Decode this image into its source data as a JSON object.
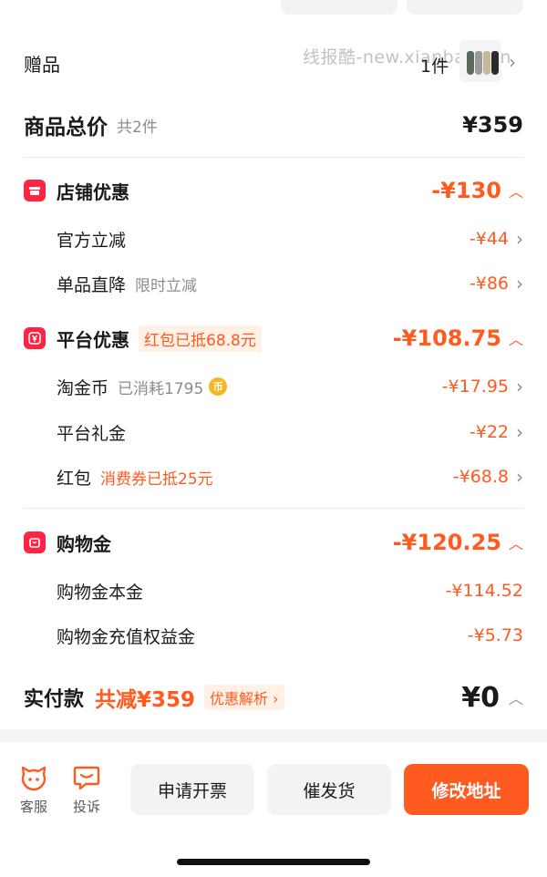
{
  "gift": {
    "label": "赠品",
    "watermark": "线报酷-new.xianbao.fun",
    "count": "1件",
    "chevron": "›"
  },
  "total": {
    "title": "商品总价",
    "count": "共2件",
    "price": "¥359"
  },
  "store_discount": {
    "title": "店铺优惠",
    "icon": "shop-icon",
    "amount": "-¥130",
    "items": [
      {
        "label": "官方立减",
        "note": "",
        "amount": "-¥44"
      },
      {
        "label": "单品直降",
        "note": "限时立减",
        "amount": "-¥86"
      }
    ]
  },
  "platform_discount": {
    "title": "平台优惠",
    "icon": "yuan-icon",
    "tag": "红包已抵68.8元",
    "amount": "-¥108.75",
    "items": [
      {
        "label": "淘金币",
        "note": "已消耗1795",
        "coin": "币",
        "amount": "-¥17.95"
      },
      {
        "label": "平台礼金",
        "note": "",
        "amount": "-¥22"
      },
      {
        "label": "红包",
        "note": "消费券已抵25元",
        "amount": "-¥68.8"
      }
    ]
  },
  "shopping_credit": {
    "title": "购物金",
    "icon": "bag-icon",
    "amount": "-¥120.25",
    "items": [
      {
        "label": "购物金本金",
        "amount": "-¥114.52"
      },
      {
        "label": "购物金充值权益金",
        "amount": "-¥5.73"
      }
    ]
  },
  "payment": {
    "title": "实付款",
    "reduced": "共减¥359",
    "analysis": "优惠解析",
    "amount": "¥0"
  },
  "bottom_bar": {
    "service_label": "客服",
    "complaint_label": "投诉",
    "invoice_label": "申请开票",
    "urge_label": "催发货",
    "address_label": "修改地址"
  },
  "colors": {
    "accent": "#ff5a1f",
    "brand_red": "#ff2442",
    "tag_bg": "#fff1e6"
  }
}
